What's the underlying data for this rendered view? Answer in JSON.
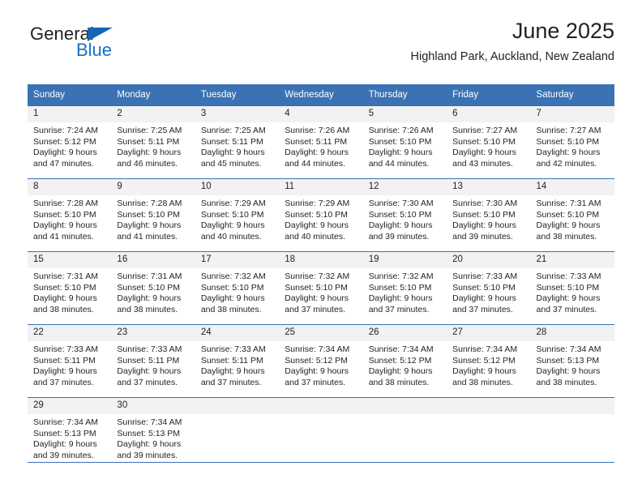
{
  "brand": {
    "name_part1": "General",
    "name_part2": "Blue",
    "triangle_icon": "triangle-icon",
    "accent_color": "#1a6fc4"
  },
  "header": {
    "title": "June 2025",
    "subtitle": "Highland Park, Auckland, New Zealand"
  },
  "theme": {
    "header_blue": "#3a72b4",
    "stripe_gray": "#f2f2f2",
    "text_color": "#231f20"
  },
  "weekday_headers": [
    "Sunday",
    "Monday",
    "Tuesday",
    "Wednesday",
    "Thursday",
    "Friday",
    "Saturday"
  ],
  "weeks": [
    [
      {
        "day": "1",
        "sunrise": "Sunrise: 7:24 AM",
        "sunset": "Sunset: 5:12 PM",
        "daylight_1": "Daylight: 9 hours",
        "daylight_2": "and 47 minutes."
      },
      {
        "day": "2",
        "sunrise": "Sunrise: 7:25 AM",
        "sunset": "Sunset: 5:11 PM",
        "daylight_1": "Daylight: 9 hours",
        "daylight_2": "and 46 minutes."
      },
      {
        "day": "3",
        "sunrise": "Sunrise: 7:25 AM",
        "sunset": "Sunset: 5:11 PM",
        "daylight_1": "Daylight: 9 hours",
        "daylight_2": "and 45 minutes."
      },
      {
        "day": "4",
        "sunrise": "Sunrise: 7:26 AM",
        "sunset": "Sunset: 5:11 PM",
        "daylight_1": "Daylight: 9 hours",
        "daylight_2": "and 44 minutes."
      },
      {
        "day": "5",
        "sunrise": "Sunrise: 7:26 AM",
        "sunset": "Sunset: 5:10 PM",
        "daylight_1": "Daylight: 9 hours",
        "daylight_2": "and 44 minutes."
      },
      {
        "day": "6",
        "sunrise": "Sunrise: 7:27 AM",
        "sunset": "Sunset: 5:10 PM",
        "daylight_1": "Daylight: 9 hours",
        "daylight_2": "and 43 minutes."
      },
      {
        "day": "7",
        "sunrise": "Sunrise: 7:27 AM",
        "sunset": "Sunset: 5:10 PM",
        "daylight_1": "Daylight: 9 hours",
        "daylight_2": "and 42 minutes."
      }
    ],
    [
      {
        "day": "8",
        "sunrise": "Sunrise: 7:28 AM",
        "sunset": "Sunset: 5:10 PM",
        "daylight_1": "Daylight: 9 hours",
        "daylight_2": "and 41 minutes."
      },
      {
        "day": "9",
        "sunrise": "Sunrise: 7:28 AM",
        "sunset": "Sunset: 5:10 PM",
        "daylight_1": "Daylight: 9 hours",
        "daylight_2": "and 41 minutes."
      },
      {
        "day": "10",
        "sunrise": "Sunrise: 7:29 AM",
        "sunset": "Sunset: 5:10 PM",
        "daylight_1": "Daylight: 9 hours",
        "daylight_2": "and 40 minutes."
      },
      {
        "day": "11",
        "sunrise": "Sunrise: 7:29 AM",
        "sunset": "Sunset: 5:10 PM",
        "daylight_1": "Daylight: 9 hours",
        "daylight_2": "and 40 minutes."
      },
      {
        "day": "12",
        "sunrise": "Sunrise: 7:30 AM",
        "sunset": "Sunset: 5:10 PM",
        "daylight_1": "Daylight: 9 hours",
        "daylight_2": "and 39 minutes."
      },
      {
        "day": "13",
        "sunrise": "Sunrise: 7:30 AM",
        "sunset": "Sunset: 5:10 PM",
        "daylight_1": "Daylight: 9 hours",
        "daylight_2": "and 39 minutes."
      },
      {
        "day": "14",
        "sunrise": "Sunrise: 7:31 AM",
        "sunset": "Sunset: 5:10 PM",
        "daylight_1": "Daylight: 9 hours",
        "daylight_2": "and 38 minutes."
      }
    ],
    [
      {
        "day": "15",
        "sunrise": "Sunrise: 7:31 AM",
        "sunset": "Sunset: 5:10 PM",
        "daylight_1": "Daylight: 9 hours",
        "daylight_2": "and 38 minutes."
      },
      {
        "day": "16",
        "sunrise": "Sunrise: 7:31 AM",
        "sunset": "Sunset: 5:10 PM",
        "daylight_1": "Daylight: 9 hours",
        "daylight_2": "and 38 minutes."
      },
      {
        "day": "17",
        "sunrise": "Sunrise: 7:32 AM",
        "sunset": "Sunset: 5:10 PM",
        "daylight_1": "Daylight: 9 hours",
        "daylight_2": "and 38 minutes."
      },
      {
        "day": "18",
        "sunrise": "Sunrise: 7:32 AM",
        "sunset": "Sunset: 5:10 PM",
        "daylight_1": "Daylight: 9 hours",
        "daylight_2": "and 37 minutes."
      },
      {
        "day": "19",
        "sunrise": "Sunrise: 7:32 AM",
        "sunset": "Sunset: 5:10 PM",
        "daylight_1": "Daylight: 9 hours",
        "daylight_2": "and 37 minutes."
      },
      {
        "day": "20",
        "sunrise": "Sunrise: 7:33 AM",
        "sunset": "Sunset: 5:10 PM",
        "daylight_1": "Daylight: 9 hours",
        "daylight_2": "and 37 minutes."
      },
      {
        "day": "21",
        "sunrise": "Sunrise: 7:33 AM",
        "sunset": "Sunset: 5:10 PM",
        "daylight_1": "Daylight: 9 hours",
        "daylight_2": "and 37 minutes."
      }
    ],
    [
      {
        "day": "22",
        "sunrise": "Sunrise: 7:33 AM",
        "sunset": "Sunset: 5:11 PM",
        "daylight_1": "Daylight: 9 hours",
        "daylight_2": "and 37 minutes."
      },
      {
        "day": "23",
        "sunrise": "Sunrise: 7:33 AM",
        "sunset": "Sunset: 5:11 PM",
        "daylight_1": "Daylight: 9 hours",
        "daylight_2": "and 37 minutes."
      },
      {
        "day": "24",
        "sunrise": "Sunrise: 7:33 AM",
        "sunset": "Sunset: 5:11 PM",
        "daylight_1": "Daylight: 9 hours",
        "daylight_2": "and 37 minutes."
      },
      {
        "day": "25",
        "sunrise": "Sunrise: 7:34 AM",
        "sunset": "Sunset: 5:12 PM",
        "daylight_1": "Daylight: 9 hours",
        "daylight_2": "and 37 minutes."
      },
      {
        "day": "26",
        "sunrise": "Sunrise: 7:34 AM",
        "sunset": "Sunset: 5:12 PM",
        "daylight_1": "Daylight: 9 hours",
        "daylight_2": "and 38 minutes."
      },
      {
        "day": "27",
        "sunrise": "Sunrise: 7:34 AM",
        "sunset": "Sunset: 5:12 PM",
        "daylight_1": "Daylight: 9 hours",
        "daylight_2": "and 38 minutes."
      },
      {
        "day": "28",
        "sunrise": "Sunrise: 7:34 AM",
        "sunset": "Sunset: 5:13 PM",
        "daylight_1": "Daylight: 9 hours",
        "daylight_2": "and 38 minutes."
      }
    ],
    [
      {
        "day": "29",
        "sunrise": "Sunrise: 7:34 AM",
        "sunset": "Sunset: 5:13 PM",
        "daylight_1": "Daylight: 9 hours",
        "daylight_2": "and 39 minutes."
      },
      {
        "day": "30",
        "sunrise": "Sunrise: 7:34 AM",
        "sunset": "Sunset: 5:13 PM",
        "daylight_1": "Daylight: 9 hours",
        "daylight_2": "and 39 minutes."
      },
      {
        "day": "",
        "sunrise": "",
        "sunset": "",
        "daylight_1": "",
        "daylight_2": ""
      },
      {
        "day": "",
        "sunrise": "",
        "sunset": "",
        "daylight_1": "",
        "daylight_2": ""
      },
      {
        "day": "",
        "sunrise": "",
        "sunset": "",
        "daylight_1": "",
        "daylight_2": ""
      },
      {
        "day": "",
        "sunrise": "",
        "sunset": "",
        "daylight_1": "",
        "daylight_2": ""
      },
      {
        "day": "",
        "sunrise": "",
        "sunset": "",
        "daylight_1": "",
        "daylight_2": ""
      }
    ]
  ]
}
